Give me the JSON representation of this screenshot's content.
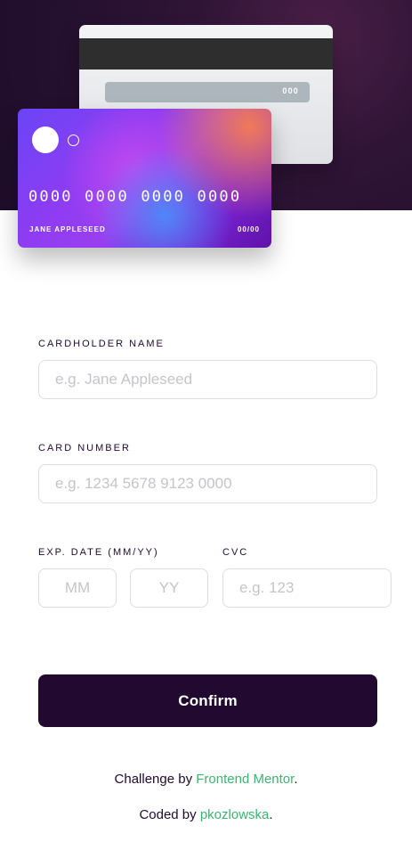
{
  "card_preview": {
    "cvc": "000",
    "number": "0000 0000 0000 0000",
    "name": "JANE APPLESEED",
    "expiry": "00/00"
  },
  "form": {
    "cardholder": {
      "label": "CARDHOLDER NAME",
      "placeholder": "e.g. Jane Appleseed"
    },
    "card_number": {
      "label": "CARD NUMBER",
      "placeholder": "e.g. 1234 5678 9123 0000"
    },
    "expiry": {
      "label": "EXP. DATE (MM/YY)",
      "month_placeholder": "MM",
      "year_placeholder": "YY"
    },
    "cvc": {
      "label": "CVC",
      "placeholder": "e.g. 123"
    },
    "confirm_label": "Confirm"
  },
  "footer": {
    "challenge_prefix": "Challenge by ",
    "challenge_link": "Frontend Mentor",
    "challenge_suffix": ".",
    "coded_prefix": "Coded by ",
    "coded_link": "pkozlowska",
    "coded_suffix": "."
  },
  "colors": {
    "dark_violet": "#21092f",
    "link_green": "#3bb56f",
    "border_grey": "#dedddf",
    "placeholder_grey": "#c6c4ca"
  }
}
